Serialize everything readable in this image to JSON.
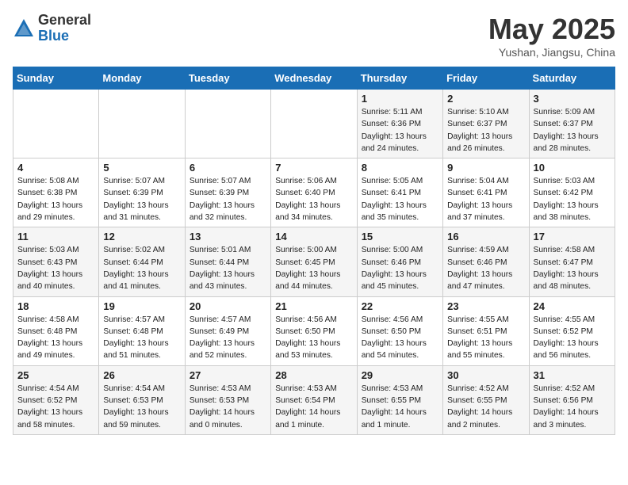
{
  "logo": {
    "general": "General",
    "blue": "Blue"
  },
  "title": "May 2025",
  "location": "Yushan, Jiangsu, China",
  "weekdays": [
    "Sunday",
    "Monday",
    "Tuesday",
    "Wednesday",
    "Thursday",
    "Friday",
    "Saturday"
  ],
  "weeks": [
    [
      {
        "day": "",
        "info": ""
      },
      {
        "day": "",
        "info": ""
      },
      {
        "day": "",
        "info": ""
      },
      {
        "day": "",
        "info": ""
      },
      {
        "day": "1",
        "info": "Sunrise: 5:11 AM\nSunset: 6:36 PM\nDaylight: 13 hours\nand 24 minutes."
      },
      {
        "day": "2",
        "info": "Sunrise: 5:10 AM\nSunset: 6:37 PM\nDaylight: 13 hours\nand 26 minutes."
      },
      {
        "day": "3",
        "info": "Sunrise: 5:09 AM\nSunset: 6:37 PM\nDaylight: 13 hours\nand 28 minutes."
      }
    ],
    [
      {
        "day": "4",
        "info": "Sunrise: 5:08 AM\nSunset: 6:38 PM\nDaylight: 13 hours\nand 29 minutes."
      },
      {
        "day": "5",
        "info": "Sunrise: 5:07 AM\nSunset: 6:39 PM\nDaylight: 13 hours\nand 31 minutes."
      },
      {
        "day": "6",
        "info": "Sunrise: 5:07 AM\nSunset: 6:39 PM\nDaylight: 13 hours\nand 32 minutes."
      },
      {
        "day": "7",
        "info": "Sunrise: 5:06 AM\nSunset: 6:40 PM\nDaylight: 13 hours\nand 34 minutes."
      },
      {
        "day": "8",
        "info": "Sunrise: 5:05 AM\nSunset: 6:41 PM\nDaylight: 13 hours\nand 35 minutes."
      },
      {
        "day": "9",
        "info": "Sunrise: 5:04 AM\nSunset: 6:41 PM\nDaylight: 13 hours\nand 37 minutes."
      },
      {
        "day": "10",
        "info": "Sunrise: 5:03 AM\nSunset: 6:42 PM\nDaylight: 13 hours\nand 38 minutes."
      }
    ],
    [
      {
        "day": "11",
        "info": "Sunrise: 5:03 AM\nSunset: 6:43 PM\nDaylight: 13 hours\nand 40 minutes."
      },
      {
        "day": "12",
        "info": "Sunrise: 5:02 AM\nSunset: 6:44 PM\nDaylight: 13 hours\nand 41 minutes."
      },
      {
        "day": "13",
        "info": "Sunrise: 5:01 AM\nSunset: 6:44 PM\nDaylight: 13 hours\nand 43 minutes."
      },
      {
        "day": "14",
        "info": "Sunrise: 5:00 AM\nSunset: 6:45 PM\nDaylight: 13 hours\nand 44 minutes."
      },
      {
        "day": "15",
        "info": "Sunrise: 5:00 AM\nSunset: 6:46 PM\nDaylight: 13 hours\nand 45 minutes."
      },
      {
        "day": "16",
        "info": "Sunrise: 4:59 AM\nSunset: 6:46 PM\nDaylight: 13 hours\nand 47 minutes."
      },
      {
        "day": "17",
        "info": "Sunrise: 4:58 AM\nSunset: 6:47 PM\nDaylight: 13 hours\nand 48 minutes."
      }
    ],
    [
      {
        "day": "18",
        "info": "Sunrise: 4:58 AM\nSunset: 6:48 PM\nDaylight: 13 hours\nand 49 minutes."
      },
      {
        "day": "19",
        "info": "Sunrise: 4:57 AM\nSunset: 6:48 PM\nDaylight: 13 hours\nand 51 minutes."
      },
      {
        "day": "20",
        "info": "Sunrise: 4:57 AM\nSunset: 6:49 PM\nDaylight: 13 hours\nand 52 minutes."
      },
      {
        "day": "21",
        "info": "Sunrise: 4:56 AM\nSunset: 6:50 PM\nDaylight: 13 hours\nand 53 minutes."
      },
      {
        "day": "22",
        "info": "Sunrise: 4:56 AM\nSunset: 6:50 PM\nDaylight: 13 hours\nand 54 minutes."
      },
      {
        "day": "23",
        "info": "Sunrise: 4:55 AM\nSunset: 6:51 PM\nDaylight: 13 hours\nand 55 minutes."
      },
      {
        "day": "24",
        "info": "Sunrise: 4:55 AM\nSunset: 6:52 PM\nDaylight: 13 hours\nand 56 minutes."
      }
    ],
    [
      {
        "day": "25",
        "info": "Sunrise: 4:54 AM\nSunset: 6:52 PM\nDaylight: 13 hours\nand 58 minutes."
      },
      {
        "day": "26",
        "info": "Sunrise: 4:54 AM\nSunset: 6:53 PM\nDaylight: 13 hours\nand 59 minutes."
      },
      {
        "day": "27",
        "info": "Sunrise: 4:53 AM\nSunset: 6:53 PM\nDaylight: 14 hours\nand 0 minutes."
      },
      {
        "day": "28",
        "info": "Sunrise: 4:53 AM\nSunset: 6:54 PM\nDaylight: 14 hours\nand 1 minute."
      },
      {
        "day": "29",
        "info": "Sunrise: 4:53 AM\nSunset: 6:55 PM\nDaylight: 14 hours\nand 1 minute."
      },
      {
        "day": "30",
        "info": "Sunrise: 4:52 AM\nSunset: 6:55 PM\nDaylight: 14 hours\nand 2 minutes."
      },
      {
        "day": "31",
        "info": "Sunrise: 4:52 AM\nSunset: 6:56 PM\nDaylight: 14 hours\nand 3 minutes."
      }
    ]
  ]
}
